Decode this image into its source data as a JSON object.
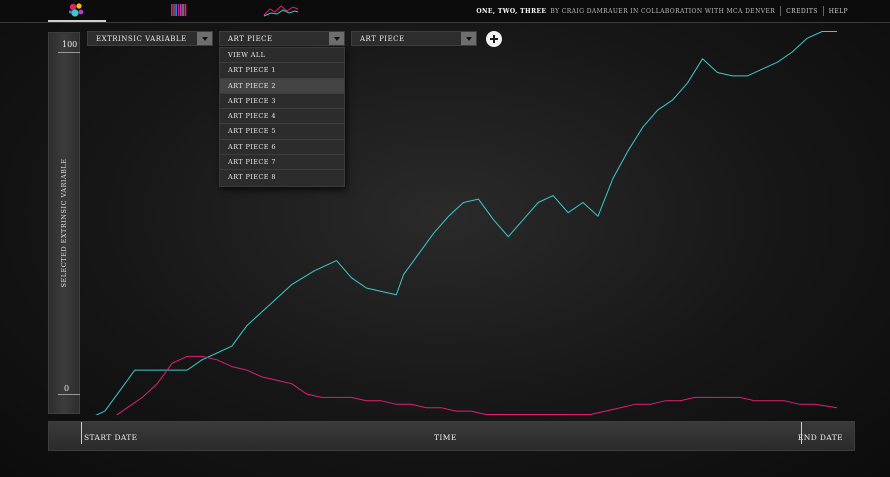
{
  "header": {
    "title": "ONE, TWO, THREE",
    "byline": "BY CRAIG DAMRAUER IN COLLABORATION WITH MCA DENVER",
    "credits": "CREDITS",
    "help": "HELP"
  },
  "nav": {
    "tabs": [
      {
        "icon": "bubbles-icon",
        "active": true
      },
      {
        "icon": "barcode-icon",
        "active": false
      },
      {
        "icon": "line-graph-icon",
        "active": false
      }
    ]
  },
  "controls": {
    "variable_select": "EXTRINSIC VARIABLE",
    "piece_select_1": "ART PIECE",
    "piece_select_2": "ART PIECE",
    "add_icon": "plus-icon"
  },
  "dropdown": {
    "items": [
      "VIEW ALL",
      "ART PIECE 1",
      "ART PIECE 2",
      "ART PIECE 3",
      "ART PIECE 4",
      "ART PIECE 5",
      "ART PIECE 6",
      "ART PIECE 7",
      "ART PIECE 8"
    ],
    "hover_index": 2
  },
  "axis": {
    "y_label": "SELECTED EXTRINSIC VARIABLE",
    "y_max": "100",
    "y_min": "0"
  },
  "timeline": {
    "start": "START DATE",
    "middle": "TIME",
    "end": "END DATE"
  },
  "colors": {
    "series_cyan": "#3ec9c9",
    "series_magenta": "#e0206f",
    "background": "#141414"
  },
  "chart_data": {
    "type": "line",
    "ylim": [
      0,
      100
    ],
    "series": [
      {
        "color": "#3ec9c9",
        "x": [
          0,
          0.02,
          0.04,
          0.06,
          0.09,
          0.11,
          0.13,
          0.15,
          0.17,
          0.19,
          0.21,
          0.24,
          0.27,
          0.3,
          0.33,
          0.35,
          0.37,
          0.39,
          0.41,
          0.42,
          0.44,
          0.46,
          0.48,
          0.5,
          0.52,
          0.54,
          0.56,
          0.58,
          0.6,
          0.62,
          0.64,
          0.66,
          0.68,
          0.7,
          0.72,
          0.74,
          0.76,
          0.78,
          0.8,
          0.82,
          0.84,
          0.86,
          0.88,
          0.9,
          0.92,
          0.94,
          0.96,
          0.98,
          1.0
        ],
        "y": [
          -7,
          -5,
          1,
          7,
          7,
          7,
          7,
          10,
          12,
          14,
          20,
          26,
          32,
          36,
          39,
          34,
          31,
          30,
          29,
          35,
          41,
          47,
          52,
          56,
          57,
          51,
          46,
          51,
          56,
          58,
          53,
          56,
          52,
          63,
          71,
          78,
          83,
          86,
          91,
          98,
          94,
          93,
          93,
          95,
          97,
          100,
          104,
          106,
          106
        ]
      },
      {
        "color": "#e0206f",
        "x": [
          0.03,
          0.05,
          0.07,
          0.09,
          0.11,
          0.13,
          0.15,
          0.17,
          0.19,
          0.21,
          0.23,
          0.25,
          0.27,
          0.29,
          0.31,
          0.33,
          0.35,
          0.37,
          0.39,
          0.41,
          0.43,
          0.45,
          0.47,
          0.49,
          0.51,
          0.53,
          0.55,
          0.57,
          0.59,
          0.61,
          0.63,
          0.65,
          0.67,
          0.69,
          0.71,
          0.73,
          0.75,
          0.77,
          0.79,
          0.81,
          0.83,
          0.85,
          0.87,
          0.89,
          0.91,
          0.93,
          0.95,
          0.97,
          1.0
        ],
        "y": [
          -7,
          -4,
          -1,
          3,
          9,
          11,
          11,
          10,
          8,
          7,
          5,
          4,
          3,
          0,
          -1,
          -1,
          -1,
          -2,
          -2,
          -3,
          -3,
          -4,
          -4,
          -5,
          -5,
          -6,
          -6,
          -6,
          -6,
          -6,
          -6,
          -6,
          -6,
          -5,
          -4,
          -3,
          -3,
          -2,
          -2,
          -1,
          -1,
          -1,
          -1,
          -2,
          -2,
          -2,
          -3,
          -3,
          -4
        ]
      }
    ]
  }
}
